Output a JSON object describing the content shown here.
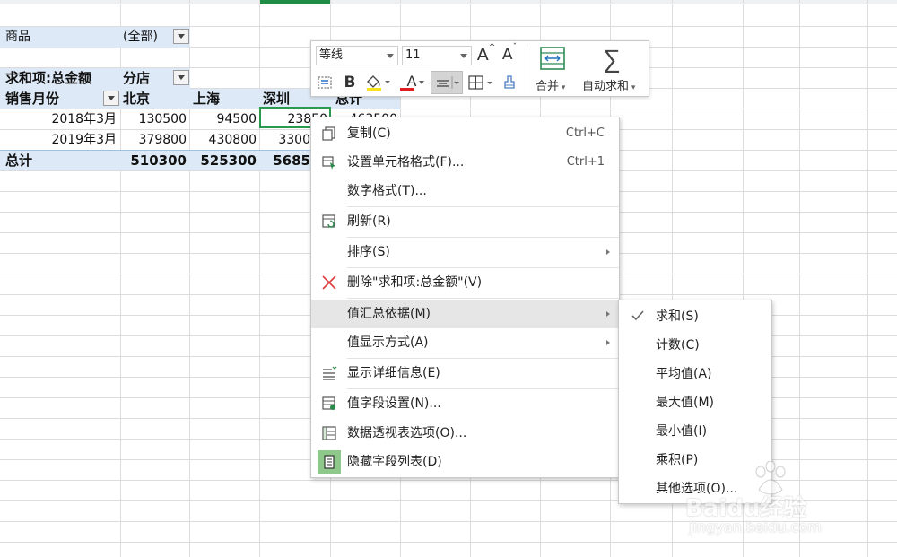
{
  "pivot": {
    "filter_label": "商品",
    "filter_value": "(全部)",
    "value_field": "求和项:总金额",
    "column_field": "分店",
    "row_field": "销售月份",
    "columns": [
      "北京",
      "上海",
      "深圳",
      "总计"
    ],
    "rows": [
      {
        "label": "2018年3月",
        "values": [
          "130500",
          "94500",
          "23850",
          "463500"
        ]
      },
      {
        "label": "2019年3月",
        "values": [
          "379800",
          "430800",
          "3300",
          ""
        ]
      }
    ],
    "total_label": "总计",
    "total_values": [
      "510300",
      "525300",
      "5685",
      ""
    ]
  },
  "toolbar": {
    "font_name": "等线",
    "font_size": "11",
    "grow_font": "A",
    "shrink_font": "A",
    "bold": "B",
    "font_color": "A",
    "merge_label": "合并",
    "autosum_label": "自动求和"
  },
  "context_menu": {
    "items": [
      {
        "label": "复制(C)",
        "shortcut": "Ctrl+C",
        "icon": "copy-icon"
      },
      {
        "label": "设置单元格格式(F)...",
        "shortcut": "Ctrl+1",
        "icon": "format-cells-icon"
      },
      {
        "label": "数字格式(T)..."
      },
      {
        "label": "刷新(R)",
        "icon": "refresh-icon"
      },
      {
        "label": "排序(S)",
        "submenu": true
      },
      {
        "label": "删除\"求和项:总金额\"(V)",
        "icon": "delete-x-icon"
      },
      {
        "label": "值汇总依据(M)",
        "submenu": true,
        "highlighted": true
      },
      {
        "label": "值显示方式(A)",
        "submenu": true
      },
      {
        "label": "显示详细信息(E)",
        "icon": "show-details-icon"
      },
      {
        "label": "值字段设置(N)...",
        "icon": "value-field-settings-icon"
      },
      {
        "label": "数据透视表选项(O)...",
        "icon": "pivot-options-icon"
      },
      {
        "label": "隐藏字段列表(D)",
        "icon": "field-list-icon"
      }
    ]
  },
  "submenu": {
    "items": [
      {
        "label": "求和(S)",
        "checked": true
      },
      {
        "label": "计数(C)"
      },
      {
        "label": "平均值(A)"
      },
      {
        "label": "最大值(M)"
      },
      {
        "label": "最小值(I)"
      },
      {
        "label": "乘积(P)"
      },
      {
        "label": "其他选项(O)..."
      }
    ]
  },
  "watermark": {
    "brand": "Baidu经验",
    "url": "jingyan.baidu.com"
  },
  "colors": {
    "header_band": "#dde9f6",
    "selection": "#2b9a51",
    "menu_highlight": "#e6e6e6",
    "delete_icon": "#e23b3b"
  }
}
